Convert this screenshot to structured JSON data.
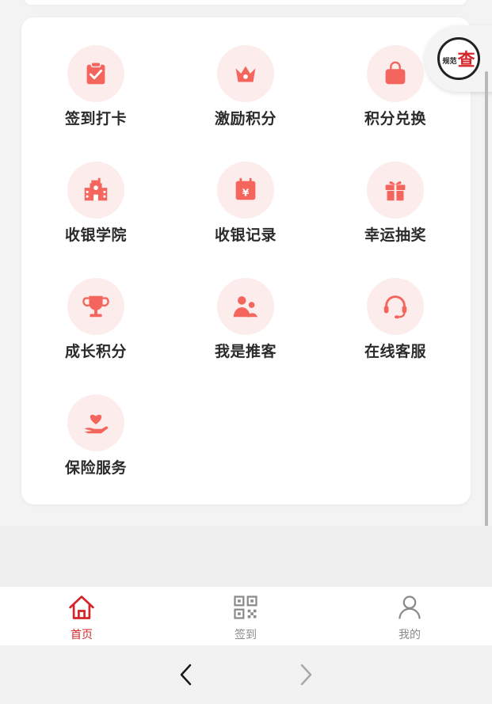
{
  "grid": [
    {
      "label": "签到打卡",
      "icon": "clipboard-check-icon"
    },
    {
      "label": "激励积分",
      "icon": "crown-icon"
    },
    {
      "label": "积分兑换",
      "icon": "shopping-bag-icon"
    },
    {
      "label": "收银学院",
      "icon": "school-building-icon"
    },
    {
      "label": "收银记录",
      "icon": "calendar-yen-icon"
    },
    {
      "label": "幸运抽奖",
      "icon": "gift-icon"
    },
    {
      "label": "成长积分",
      "icon": "trophy-icon"
    },
    {
      "label": "我是推客",
      "icon": "people-icon"
    },
    {
      "label": "在线客服",
      "icon": "headset-icon"
    },
    {
      "label": "保险服务",
      "icon": "hand-heart-icon"
    }
  ],
  "badge": {
    "small": "规范",
    "big": "查"
  },
  "tabbar": [
    {
      "label": "首页",
      "icon": "home-icon",
      "active": true
    },
    {
      "label": "签到",
      "icon": "qr-code-icon",
      "active": false
    },
    {
      "label": "我的",
      "icon": "user-icon",
      "active": false
    }
  ],
  "colors": {
    "accent": "#d4262a",
    "icon_fill": "#f4655e",
    "icon_bg": "#fdecec"
  }
}
